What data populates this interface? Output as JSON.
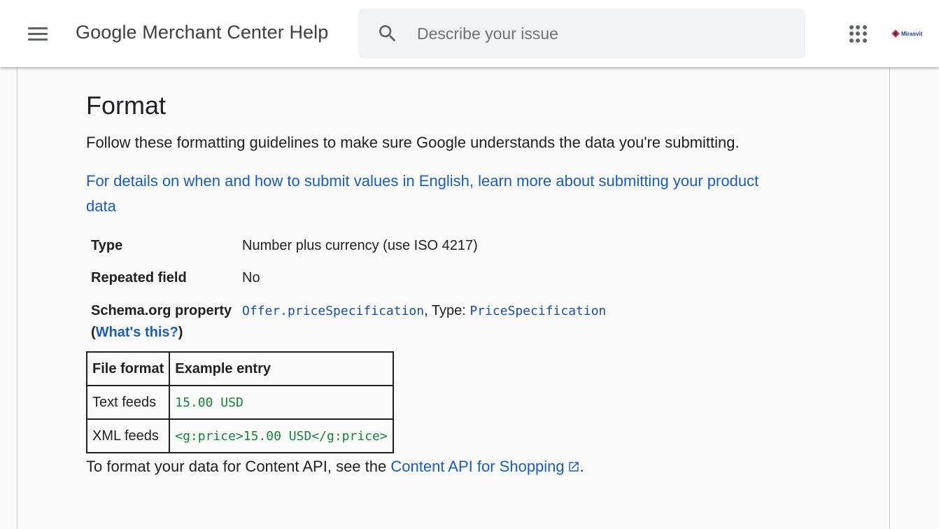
{
  "header": {
    "title": "Google Merchant Center Help",
    "search_placeholder": "Describe your issue",
    "brand_label": "Mirasvit"
  },
  "section": {
    "title": "Format",
    "intro": "Follow these formatting guidelines to make sure Google understands the data you're submitting.",
    "details_link": "For details on when and how to submit values in English, learn more about submitting your product data"
  },
  "attributes": {
    "type_label": "Type",
    "type_value": "Number plus currency (use ISO 4217)",
    "repeated_label": "Repeated field",
    "repeated_value": "No",
    "schema_label": "Schema.org property",
    "whats_this": "What's this?",
    "schema_code_1": "Offer.priceSpecification",
    "schema_mid": ", Type: ",
    "schema_code_2": "PriceSpecification"
  },
  "example_table": {
    "headers": [
      "File format",
      "Example entry"
    ],
    "rows": [
      [
        "Text feeds",
        "15.00 USD"
      ],
      [
        "XML feeds",
        "<g:price>15.00 USD</g:price>"
      ]
    ]
  },
  "api_note": {
    "prefix": "To format your data for Content API, see the ",
    "link": "Content API for Shopping",
    "suffix": "."
  },
  "colors": {
    "link": "#1a5cb8",
    "code_blue": "#174ea6",
    "code_green": "#188038",
    "icon_gray": "#5f6368"
  }
}
